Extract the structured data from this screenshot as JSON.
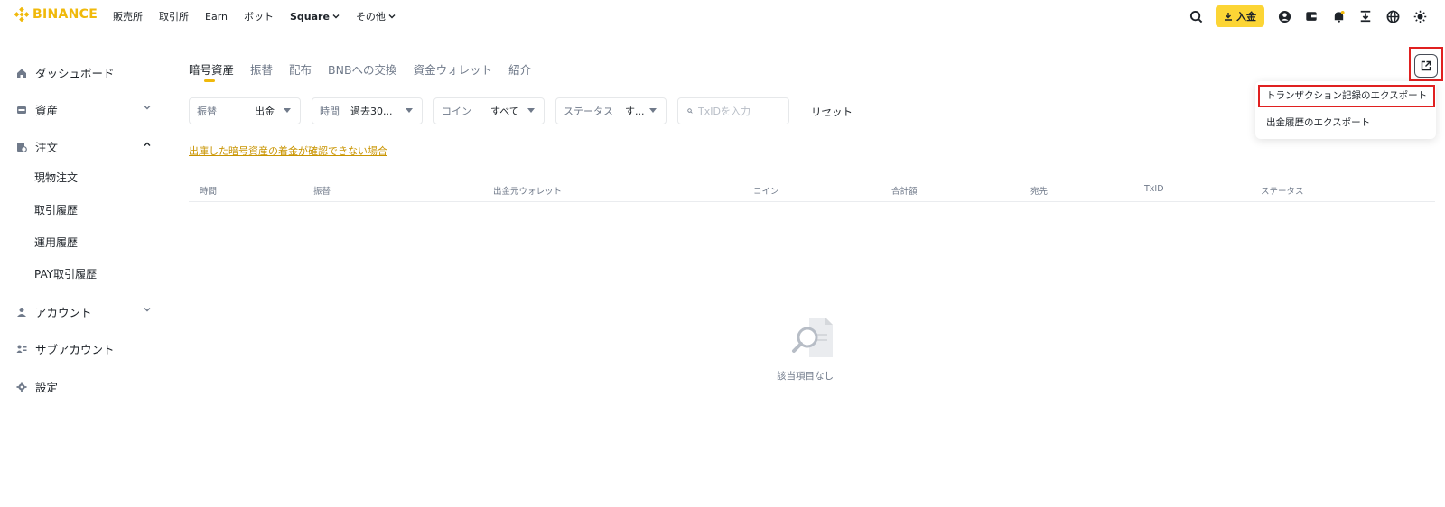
{
  "brand": {
    "name": "BINANCE",
    "color": "#f0b90b"
  },
  "nav": [
    {
      "label": "販売所",
      "dropdown": false,
      "bold": false
    },
    {
      "label": "取引所",
      "dropdown": false,
      "bold": false
    },
    {
      "label": "Earn",
      "dropdown": false,
      "bold": false
    },
    {
      "label": "ボット",
      "dropdown": false,
      "bold": false
    },
    {
      "label": "Square",
      "dropdown": true,
      "bold": true
    },
    {
      "label": "その他",
      "dropdown": true,
      "bold": false
    }
  ],
  "header": {
    "deposit_label": "入金",
    "icons": [
      "search-icon",
      "profile-icon",
      "wallet-icon",
      "bell-icon",
      "download-app-icon",
      "globe-icon",
      "theme-icon"
    ]
  },
  "sidebar": {
    "items": [
      {
        "label": "ダッシュボード",
        "icon": "home-icon"
      },
      {
        "label": "資産",
        "icon": "wallet-icon",
        "chevron": "down"
      },
      {
        "label": "注文",
        "icon": "orders-icon",
        "chevron": "up"
      },
      {
        "label": "アカウント",
        "icon": "user-icon",
        "chevron": "down"
      },
      {
        "label": "サブアカウント",
        "icon": "sub-account-icon"
      },
      {
        "label": "設定",
        "icon": "gear-icon"
      }
    ],
    "sub_items": [
      "現物注文",
      "取引履歴",
      "運用履歴",
      "PAY取引履歴"
    ]
  },
  "tabs": [
    "暗号資産",
    "振替",
    "配布",
    "BNBへの交換",
    "資金ウォレット",
    "紹介"
  ],
  "filters": {
    "transfer": {
      "label": "振替",
      "value": "出金"
    },
    "time": {
      "label": "時間",
      "value": "過去30..."
    },
    "coin": {
      "label": "コイン",
      "value": "すべて"
    },
    "status": {
      "label": "ステータス",
      "value": "す..."
    },
    "txid_placeholder": "TxIDを入力",
    "reset_label": "リセット"
  },
  "warning_link": "出庫した暗号資産の着金が確認できない場合",
  "table": {
    "columns": [
      "時間",
      "振替",
      "出金元ウォレット",
      "コイン",
      "合計額",
      "宛先",
      "TxID",
      "ステータス"
    ],
    "empty_text": "該当項目なし"
  },
  "export_menu": {
    "items": [
      "トランザクション記録のエクスポート",
      "出金履歴のエクスポート"
    ]
  },
  "colors": {
    "accent": "#fcd535",
    "link": "#c99400",
    "highlight": "#e02020"
  }
}
